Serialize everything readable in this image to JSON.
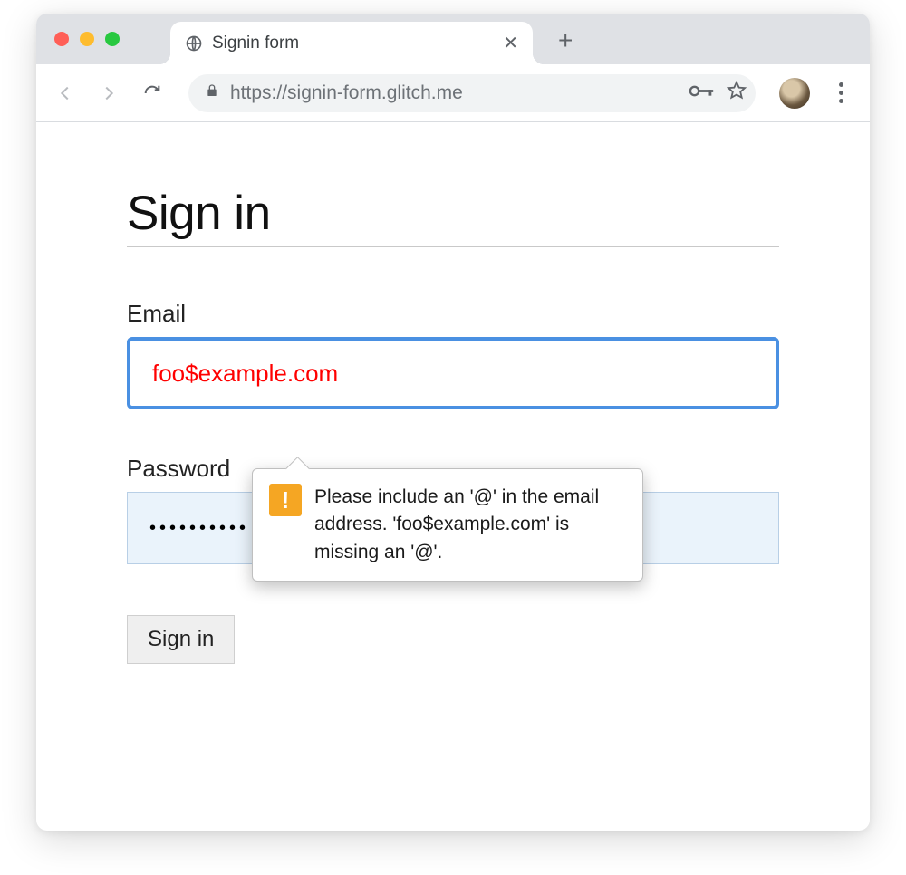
{
  "browser": {
    "tab_title": "Signin form",
    "url": "https://signin-form.glitch.me"
  },
  "page": {
    "title": "Sign in",
    "email_label": "Email",
    "email_value": "foo$example.com",
    "password_label": "Password",
    "password_value": "••••••••••",
    "submit_label": "Sign in"
  },
  "validation": {
    "message": "Please include an '@' in the email address. 'foo$example.com' is missing an '@'."
  }
}
